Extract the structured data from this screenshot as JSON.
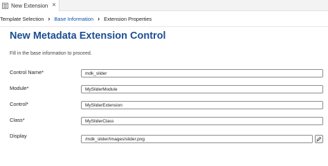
{
  "tab": {
    "title": "New Extension",
    "close_glyph": "×",
    "icon": "document-icon"
  },
  "breadcrumb": {
    "items": [
      {
        "label": "Template Selection",
        "active": false
      },
      {
        "label": "Base Information",
        "active": true
      },
      {
        "label": "Extension Properties",
        "active": false
      }
    ]
  },
  "page": {
    "title": "New Metadata Extension Control",
    "subtitle": "Fill in the base information to proceed."
  },
  "form": {
    "control_name": {
      "label": "Control Name*",
      "value": "mdk_slider"
    },
    "module": {
      "label": "Module*",
      "value": "MySliderModule"
    },
    "control": {
      "label": "Control*",
      "value": "MySliderExtension"
    },
    "class": {
      "label": "Class*",
      "value": "MySliderClass"
    },
    "display": {
      "label": "Display",
      "value": "/mdk_slider/Images/slider.png",
      "browse_icon": "edit-pencil-icon"
    }
  },
  "colors": {
    "accent": "#1b4e93",
    "active_crumb": "#0a4fa8"
  }
}
